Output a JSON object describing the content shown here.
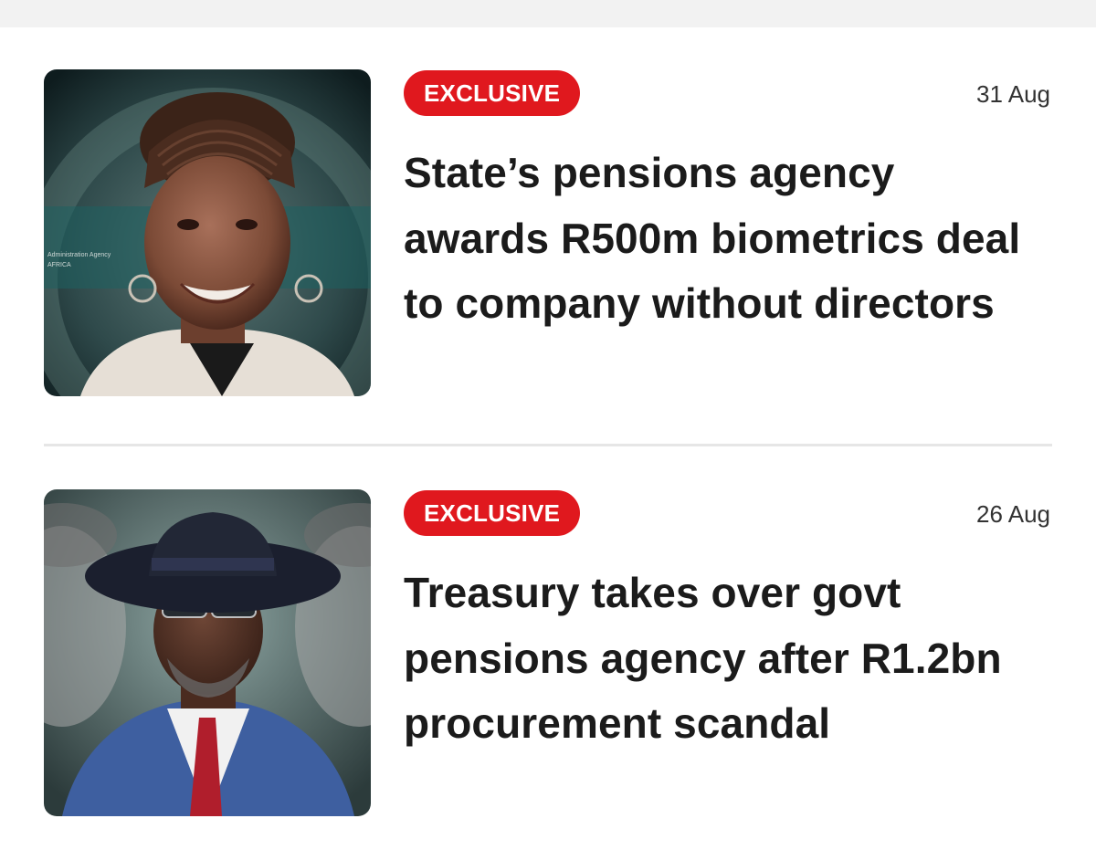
{
  "articles": [
    {
      "badge": "EXCLUSIVE",
      "date": "31 Aug",
      "headline": "State’s pensions agency awards R500m biometrics deal to company without directors",
      "image_text": [
        "Administration Agency",
        "AFRICA"
      ]
    },
    {
      "badge": "EXCLUSIVE",
      "date": "26 Aug",
      "headline": "Treasury takes over govt pensions agency after R1.2bn procurement scandal"
    }
  ],
  "colors": {
    "badge_bg": "#e0181e",
    "badge_text": "#ffffff",
    "headline": "#1b1b1b",
    "date": "#333333",
    "divider": "#e6e6e6",
    "top_strip": "#f2f2f2"
  }
}
